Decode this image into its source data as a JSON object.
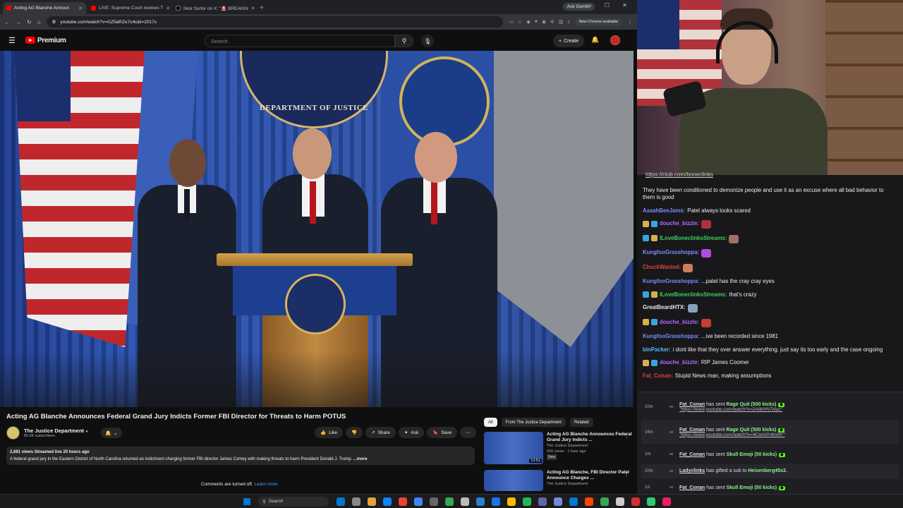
{
  "browser": {
    "tabs": [
      {
        "label": "Acting AG Blanche Announ",
        "active": true,
        "color": "#ff0000"
      },
      {
        "label": "LIVE: Supreme Court reviews T",
        "active": false,
        "color": "#ff0000"
      },
      {
        "label": "Nick Sortor on X: \"🚨 BREAKIN",
        "active": false,
        "color": "#000000"
      },
      {
        "label": "",
        "active": false,
        "color": "#e0a040"
      }
    ],
    "ask_gemini": "Ask Gemini",
    "url": "youtube.com/watch?v=GZ5aRZe7c4c&t=2017s",
    "new_chrome": "New Chrome available"
  },
  "youtube": {
    "logo_text": "Premium",
    "search_placeholder": "Search",
    "create_label": "Create",
    "video_title": "Acting AG Blanche Announces Federal Grand Jury Indicts Former FBI Director for Threats to Harm POTUS",
    "channel_name": "The Justice Department",
    "channel_subs": "85.5K subscribers",
    "actions": {
      "like": "Like",
      "share": "Share",
      "ask": "Ask",
      "save": "Save"
    },
    "desc_stats": "2,681 views  Streamed live 20 hours ago",
    "desc_text": "A federal grand jury in the Eastern District of North Carolina returned an indictment charging former FBI director James Comey with making threats to harm President Donald J. Trump.",
    "desc_more": "...more",
    "comments_off": "Comments are turned off.",
    "learn_more": "Learn more",
    "video_scene": {
      "backdrop_seal_text": "DEPARTMENT OF JUSTICE"
    },
    "related_tabs": [
      "All",
      "From The Justice Department",
      "Related"
    ],
    "related": [
      {
        "title": "Acting AG Blanche Announces Federal Grand Jury Indicts ...",
        "channel": "The Justice Department",
        "meta": "500 views · 1 hour ago",
        "badge": "New",
        "duration": "13:51"
      },
      {
        "title": "Acting AG Blanche, FBI Director Patel Announce Charges ...",
        "channel": "The Justice Department",
        "meta": "",
        "badge": "",
        "duration": ""
      }
    ]
  },
  "stream": {
    "club_link": "https://club.com/boneclinks",
    "chat": [
      {
        "user": "",
        "color": "#ff4444",
        "text": "They have been conditioned to demonize people and use it as an excuse where all bad behavior to them is good",
        "badges": []
      },
      {
        "user": "AaaahBeeJams:",
        "color": "#7a8cff",
        "text": "Patel always looks scared",
        "badges": []
      },
      {
        "user": "douche_bizzle:",
        "color": "#b26bff",
        "text": "",
        "badges": [
          "#d8b04a",
          "#3aa4e0"
        ],
        "emote": "#b03040"
      },
      {
        "user": "ILoveBoneclinksStreams:",
        "color": "#3ad35a",
        "text": "",
        "badges": [
          "#3aa4e0",
          "#d8b04a"
        ],
        "emote": "#a07060"
      },
      {
        "user": "KungfooGrasshoppa:",
        "color": "#7a8cff",
        "text": "",
        "badges": [],
        "emote": "#b24be0"
      },
      {
        "user": "ChuckWanted:",
        "color": "#e04040",
        "text": "",
        "badges": [],
        "emote": "#d07a5a"
      },
      {
        "user": "KungfooGrasshoppa:",
        "color": "#7a8cff",
        "text": "...patel has the cray cray eyes",
        "badges": []
      },
      {
        "user": "ILoveBoneclinksStreams:",
        "color": "#3ad35a",
        "text": "that's crazy",
        "badges": [
          "#3aa4e0",
          "#d8b04a"
        ]
      },
      {
        "user": "GreatBeardHTX:",
        "color": "#e8e8e8",
        "text": "",
        "badges": [],
        "emote": "#8aa0b8"
      },
      {
        "user": "douche_bizzle:",
        "color": "#b26bff",
        "text": "",
        "badges": [
          "#d8b04a",
          "#3aa4e0"
        ],
        "emote": "#c04030"
      },
      {
        "user": "KungfooGrasshoppa:",
        "color": "#7a8cff",
        "text": "...ive been recorded since 1981",
        "badges": []
      },
      {
        "user": "binPacker:",
        "color": "#5ab8ff",
        "text": "i dont like that they over answer everything. just say its too early and the case ongoing",
        "badges": []
      },
      {
        "user": "douche_bizzle:",
        "color": "#b26bff",
        "text": "RIP James Coomer",
        "badges": [
          "#d8b04a",
          "#3aa4e0"
        ]
      },
      {
        "user": "Fat_Conan:",
        "color": "#e04040",
        "text": "Stupid News man, making assumptions",
        "badges": []
      }
    ],
    "events": [
      {
        "time": "10m",
        "name": "Fat_Conan",
        "verb": "has sent",
        "gift": "Rage Quit (500 kicks)",
        "link": "\"https://www.youtube.com/watch?v=2AlMXNTkIuc\"",
        "kick": "⬢"
      },
      {
        "time": "16m",
        "name": "Fat_Conan",
        "verb": "has sent",
        "gift": "Rage Quit (500 kicks)",
        "link": "\"https://www.youtube.com/watch?v=4CwVdY4mRY\"",
        "kick": "⬢"
      },
      {
        "time": "1hr",
        "name": "Fat_Conan",
        "verb": "has sent",
        "gift": "Skull Emoji (50 kicks)",
        "link": "",
        "kick": "⬢"
      },
      {
        "time": "20hr",
        "name": "Ladyclinks",
        "verb": "has gifted a sub to",
        "gift": "Heisenberg45x2.",
        "link": "",
        "kick": ""
      },
      {
        "time": "1d",
        "name": "Fat_Conan",
        "verb": "has sent",
        "gift": "Skull Emoji (50 kicks)",
        "link": "",
        "kick": "⬢"
      },
      {
        "time": "1d",
        "name": "EuclideanG",
        "verb": "has gifted a sub to",
        "gift": "pow66.",
        "link": "",
        "kick": ""
      }
    ]
  },
  "taskbar": {
    "search_label": "Search",
    "icons": [
      "#0078d4",
      "#888888",
      "#e6a23c",
      "#0a84ff",
      "#ea4335",
      "#4285f4",
      "#666666",
      "#34a853",
      "#bbbbbb",
      "#2d7dd2",
      "#1a73e8",
      "#fbbc05",
      "#1db954",
      "#6264a7",
      "#7289da",
      "#0078d4",
      "#ff4500",
      "#34a853",
      "#cccccc",
      "#d32f2f",
      "#2ecc71",
      "#e91e63"
    ]
  }
}
